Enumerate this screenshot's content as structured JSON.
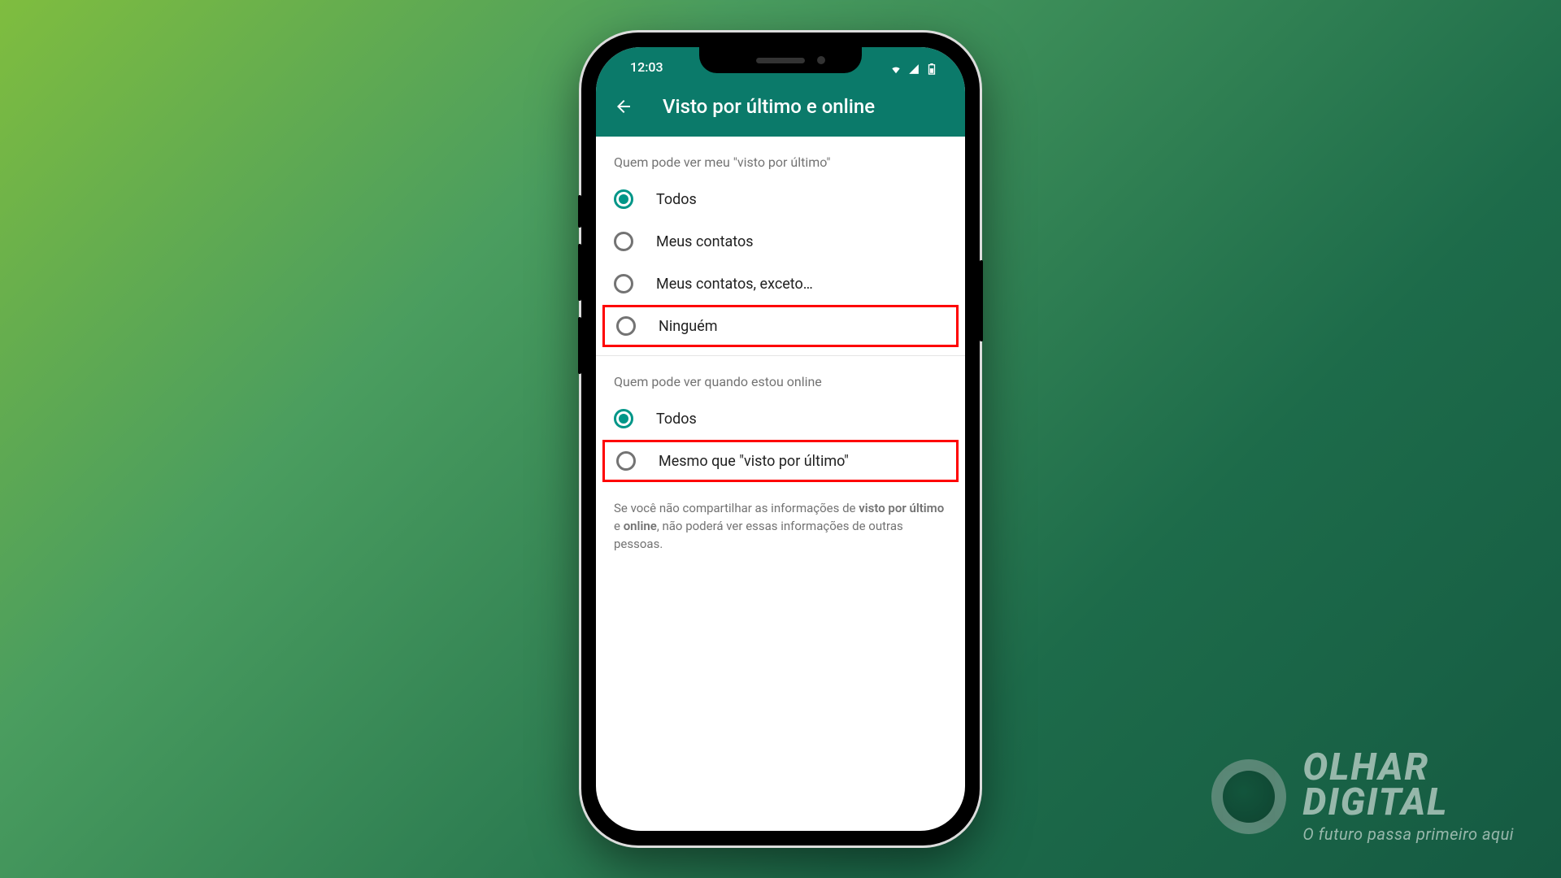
{
  "status": {
    "time": "12:03"
  },
  "header": {
    "title": "Visto por último e online"
  },
  "section1": {
    "title": "Quem pode ver meu \"visto por último\"",
    "options": [
      {
        "label": "Todos",
        "selected": true,
        "hl": false
      },
      {
        "label": "Meus contatos",
        "selected": false,
        "hl": false
      },
      {
        "label": "Meus contatos, exceto…",
        "selected": false,
        "hl": false
      },
      {
        "label": "Ninguém",
        "selected": false,
        "hl": true
      }
    ]
  },
  "section2": {
    "title": "Quem pode ver quando estou online",
    "options": [
      {
        "label": "Todos",
        "selected": true,
        "hl": false
      },
      {
        "label": "Mesmo que \"visto por último\"",
        "selected": false,
        "hl": true
      }
    ]
  },
  "help": {
    "pre": "Se você não compartilhar as informações de ",
    "b1": "visto por último",
    "mid1": " e ",
    "b2": "online",
    "post": ", não poderá ver essas informações de outras pessoas."
  },
  "brand": {
    "l1": "OLHAR",
    "l2": "DIGITAL",
    "tag": "O futuro passa primeiro aqui"
  }
}
